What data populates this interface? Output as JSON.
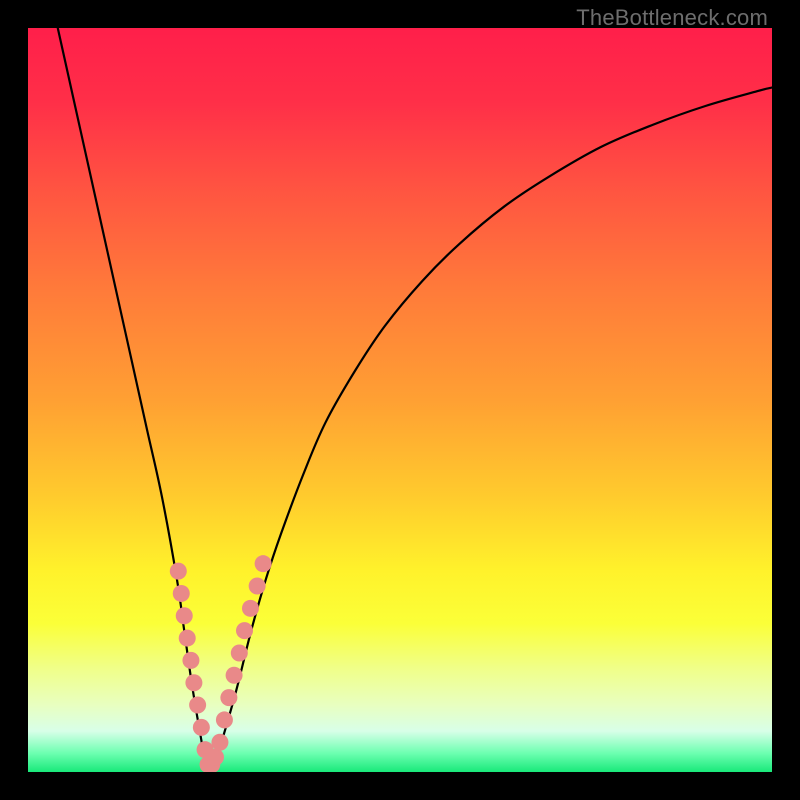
{
  "watermark": "TheBottleneck.com",
  "gradient_stops": [
    {
      "offset": 0.0,
      "color": "#ff1f4a"
    },
    {
      "offset": 0.1,
      "color": "#ff2f48"
    },
    {
      "offset": 0.22,
      "color": "#ff5541"
    },
    {
      "offset": 0.35,
      "color": "#ff7a3a"
    },
    {
      "offset": 0.5,
      "color": "#ffa033"
    },
    {
      "offset": 0.63,
      "color": "#ffcb2d"
    },
    {
      "offset": 0.73,
      "color": "#fff22b"
    },
    {
      "offset": 0.8,
      "color": "#fbff38"
    },
    {
      "offset": 0.86,
      "color": "#f0ff88"
    },
    {
      "offset": 0.91,
      "color": "#e8ffc0"
    },
    {
      "offset": 0.945,
      "color": "#d8ffe8"
    },
    {
      "offset": 0.975,
      "color": "#6cffb0"
    },
    {
      "offset": 1.0,
      "color": "#19e97a"
    }
  ],
  "chart_data": {
    "type": "line",
    "title": "",
    "xlabel": "",
    "ylabel": "",
    "xlim": [
      0,
      100
    ],
    "ylim": [
      0,
      100
    ],
    "annotations": [
      "TheBottleneck.com"
    ],
    "x_min_point": 24,
    "series": [
      {
        "name": "bottleneck-curve",
        "color": "#000000",
        "x": [
          4,
          6,
          8,
          10,
          12,
          14,
          16,
          18,
          20,
          21,
          22,
          23,
          24,
          25,
          26,
          28,
          30,
          32,
          34,
          37,
          40,
          44,
          48,
          53,
          58,
          64,
          70,
          77,
          84,
          91,
          98,
          100
        ],
        "y": [
          100,
          91,
          82,
          73,
          64,
          55,
          46,
          37,
          26,
          19,
          12,
          6,
          1,
          1,
          4,
          11,
          19,
          26,
          32,
          40,
          47,
          54,
          60,
          66,
          71,
          76,
          80,
          84,
          87,
          89.5,
          91.5,
          92
        ]
      },
      {
        "name": "dense-markers",
        "color": "#e98989",
        "type": "scatter",
        "x": [
          20.2,
          20.6,
          21.0,
          21.4,
          21.9,
          22.3,
          22.8,
          23.3,
          23.8,
          24.2,
          24.7,
          25.2,
          25.8,
          26.4,
          27.0,
          27.7,
          28.4,
          29.1,
          29.9,
          30.8,
          31.6
        ],
        "y": [
          27,
          24,
          21,
          18,
          15,
          12,
          9,
          6,
          3,
          1,
          1,
          2,
          4,
          7,
          10,
          13,
          16,
          19,
          22,
          25,
          28
        ]
      }
    ]
  }
}
